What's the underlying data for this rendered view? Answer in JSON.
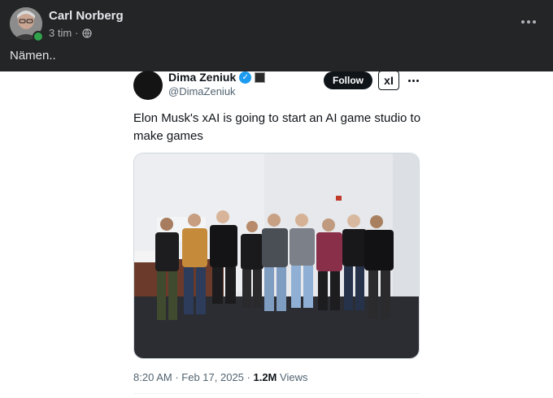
{
  "post": {
    "author": "Carl Norberg",
    "time": "3 tim",
    "separator": "·",
    "audience_icon": "globe-icon",
    "caption": "Nämen..",
    "more_icon": "more-horizontal-icon",
    "online_color": "#31a24c"
  },
  "tweet": {
    "display_name": "Dima Zeniuk",
    "handle": "@DimaZeniuk",
    "verified_icon": "verified-badge-icon",
    "follow_label": "Follow",
    "org_logo": "xI",
    "text": "Elon Musk's xAI is going to start an AI game studio to make games",
    "photo_description_icon": "group-photo",
    "time": "8:20 AM",
    "date": "Feb 17, 2025",
    "views_count": "1.2M",
    "views_label": "Views",
    "accent_color": "#1d9bf0"
  }
}
